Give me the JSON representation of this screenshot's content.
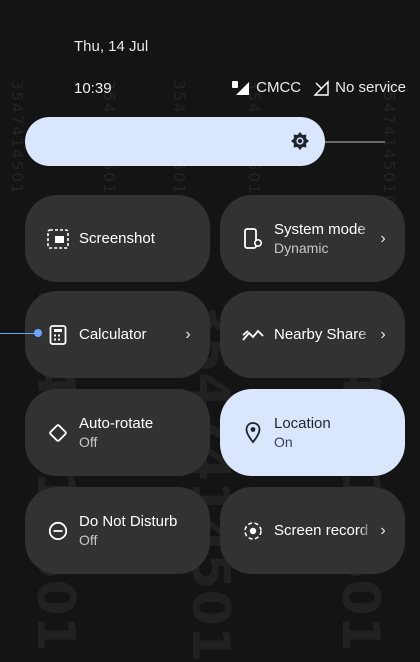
{
  "header": {
    "date": "Thu, 14 Jul",
    "time": "10:39"
  },
  "status": {
    "carrier": "CMCC",
    "service": "No service"
  },
  "brightness": {
    "icon": "brightness-icon"
  },
  "tiles": [
    {
      "label": "Screenshot",
      "sub": "",
      "icon": "screenshot-icon",
      "active": false
    },
    {
      "label": "System mode",
      "sub": "Dynamic",
      "icon": "system-mode-icon",
      "active": false
    },
    {
      "label": "Calculator",
      "sub": "",
      "icon": "calculator-icon",
      "active": false
    },
    {
      "label": "Nearby Share",
      "sub": "",
      "icon": "nearby-share-icon",
      "active": false
    },
    {
      "label": "Auto-rotate",
      "sub": "Off",
      "icon": "auto-rotate-icon",
      "active": false
    },
    {
      "label": "Location",
      "sub": "On",
      "icon": "location-icon",
      "active": true
    },
    {
      "label": "Do Not Disturb",
      "sub": "Off",
      "icon": "do-not-disturb-icon",
      "active": false
    },
    {
      "label": "Screen record",
      "sub": "",
      "icon": "screen-record-icon",
      "active": false
    }
  ],
  "colors": {
    "accent": "#d9e6fb",
    "tile": "#323232",
    "background": "#141414"
  }
}
